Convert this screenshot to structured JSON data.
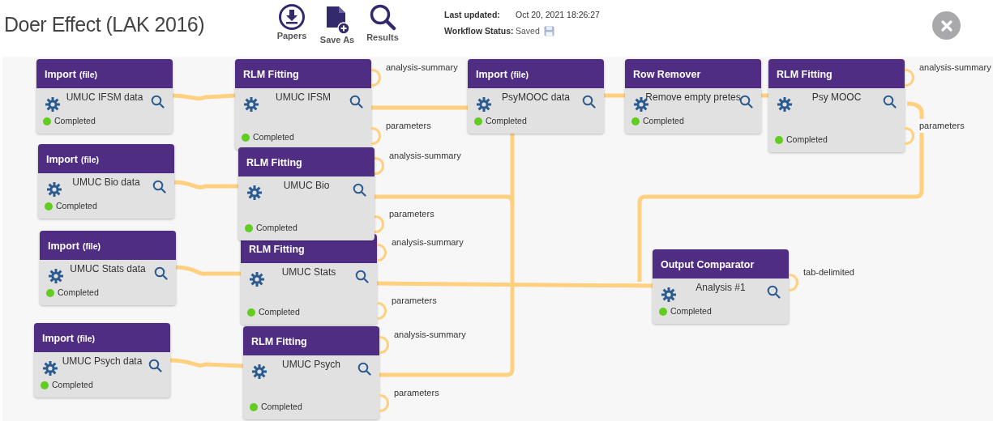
{
  "header": {
    "title": "Doer Effect (LAK 2016)",
    "toolbar": [
      {
        "kind": "papers",
        "label": "Papers"
      },
      {
        "kind": "save_as",
        "label": "Save As"
      },
      {
        "kind": "results",
        "label": "Results"
      }
    ],
    "last_updated_label": "Last updated:",
    "last_updated": "Oct 20, 2021 18:26:27",
    "status_label": "Workflow Status:",
    "status": "Saved"
  },
  "nodes": [
    {
      "title": "Import",
      "title_note": "(file)",
      "name": "UMUC IFSM data",
      "status": "Completed"
    },
    {
      "title": "RLM Fitting",
      "name": "UMUC IFSM",
      "status": "Completed",
      "outputs": [
        "analysis-summary",
        "parameters"
      ]
    },
    {
      "title": "Import",
      "title_note": "(file)",
      "name": "PsyMOOC data",
      "status": "Completed"
    },
    {
      "title": "Row Remover",
      "name": "Remove empty pretes",
      "status": "Completed"
    },
    {
      "title": "RLM Fitting",
      "name": "Psy MOOC",
      "status": "Completed",
      "outputs": [
        "analysis-summary",
        "parameters"
      ]
    },
    {
      "title": "Import",
      "title_note": "(file)",
      "name": "UMUC Bio data",
      "status": "Completed"
    },
    {
      "title": "RLM Fitting",
      "name": "UMUC Bio",
      "status": "Completed",
      "outputs": [
        "analysis-summary",
        "parameters"
      ]
    },
    {
      "title": "Import",
      "title_note": "(file)",
      "name": "UMUC Stats data",
      "status": "Completed"
    },
    {
      "title": "RLM Fitting",
      "name": "UMUC Stats",
      "status": "Completed",
      "outputs": [
        "analysis-summary",
        "parameters"
      ]
    },
    {
      "title": "Import",
      "title_note": "(file)",
      "name": "UMUC Psych data",
      "status": "Completed"
    },
    {
      "title": "RLM Fitting",
      "name": "UMUC Psych",
      "status": "Completed",
      "outputs": [
        "analysis-summary",
        "parameters"
      ]
    },
    {
      "title": "Output Comparator",
      "name": "Analysis #1",
      "status": "Completed",
      "outputs": [
        "tab-delimited"
      ]
    }
  ]
}
